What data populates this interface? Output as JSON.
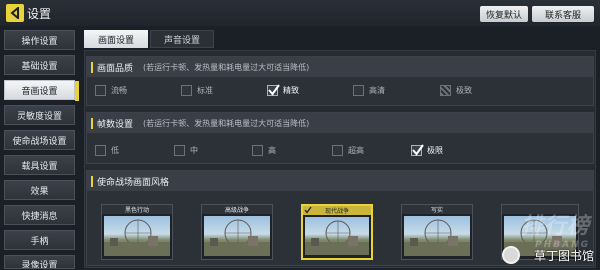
{
  "header": {
    "title": "设置",
    "restore_default_label": "恢复默认",
    "contact_support_label": "联系客服"
  },
  "sidebar": {
    "items": [
      {
        "label": "操作设置",
        "active": false
      },
      {
        "label": "基础设置",
        "active": false
      },
      {
        "label": "音画设置",
        "active": true
      },
      {
        "label": "灵敏度设置",
        "active": false
      },
      {
        "label": "使命战场设置",
        "active": false
      },
      {
        "label": "载具设置",
        "active": false
      },
      {
        "label": "效果",
        "active": false
      },
      {
        "label": "快捷消息",
        "active": false
      },
      {
        "label": "手柄",
        "active": false
      },
      {
        "label": "录像设置",
        "active": false
      }
    ]
  },
  "tabs": {
    "display_label": "画面设置",
    "audio_label": "声音设置"
  },
  "quality": {
    "title": "画面品质",
    "hint": "(若运行卡顿、发热量和耗电量过大可适当降低)",
    "options": [
      {
        "label": "流畅",
        "state": "unchecked"
      },
      {
        "label": "标准",
        "state": "unchecked"
      },
      {
        "label": "精致",
        "state": "checked"
      },
      {
        "label": "高清",
        "state": "unchecked"
      },
      {
        "label": "极致",
        "state": "locked"
      }
    ]
  },
  "framerate": {
    "title": "帧数设置",
    "hint": "(若运行卡顿、发热量和耗电量过大可适当降低)",
    "options": [
      {
        "label": "低",
        "state": "unchecked"
      },
      {
        "label": "中",
        "state": "unchecked"
      },
      {
        "label": "高",
        "state": "unchecked"
      },
      {
        "label": "超高",
        "state": "unchecked"
      },
      {
        "label": "极限",
        "state": "checked"
      }
    ]
  },
  "style": {
    "title": "使命战场画面风格",
    "thumbnails": [
      {
        "caption": "黑色行动",
        "selected": false
      },
      {
        "caption": "高级战争",
        "selected": false
      },
      {
        "caption": "现代战争",
        "selected": true
      },
      {
        "caption": "写实",
        "selected": false
      },
      {
        "caption": "",
        "selected": false
      }
    ]
  },
  "watermark": {
    "brand": "排行榜",
    "brand_latin": "PHBANG",
    "site": "草丁图书馆"
  },
  "colors": {
    "accent": "#e8d43a",
    "background": "#1b2027"
  }
}
